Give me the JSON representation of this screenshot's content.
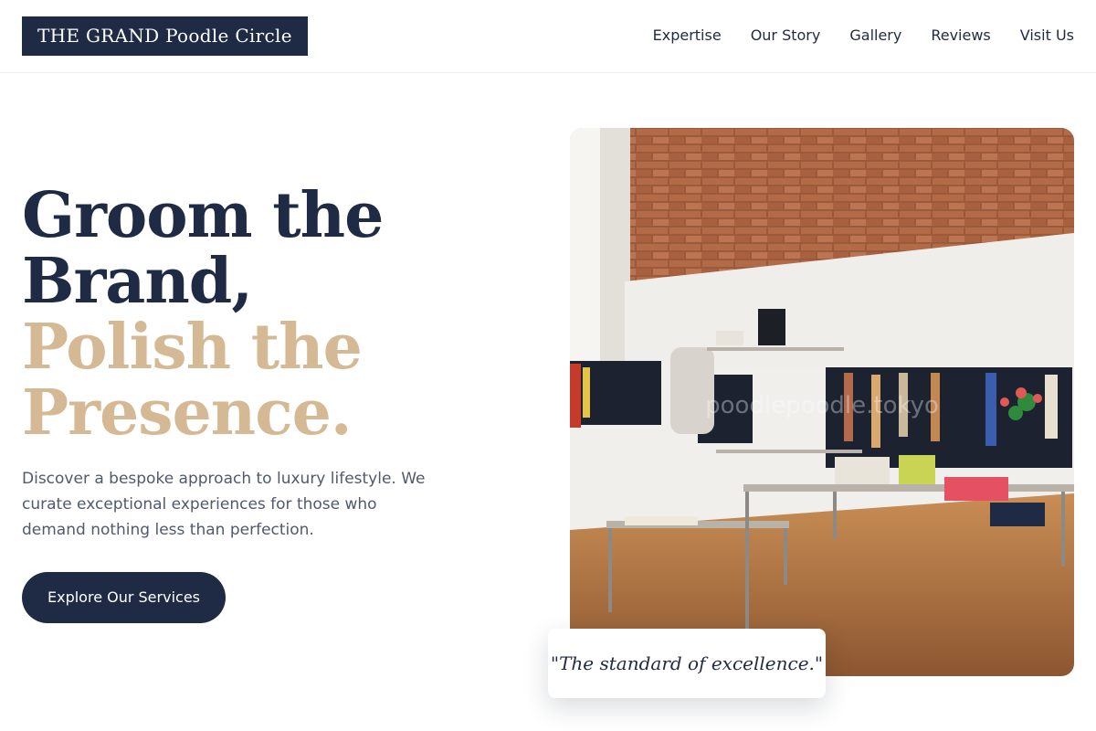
{
  "brand": {
    "name": "THE GRAND Poodle Circle"
  },
  "nav": {
    "items": [
      "Expertise",
      "Our Story",
      "Gallery",
      "Reviews",
      "Visit Us"
    ]
  },
  "hero": {
    "headline_line1": "Groom the",
    "headline_line2": "Brand,",
    "headline_accent_line1": "Polish the",
    "headline_accent_line2": "Presence.",
    "description": "Discover a bespoke approach to luxury lifestyle. We curate exceptional experiences for those who demand nothing less than perfection.",
    "cta_label": "Explore Our Services"
  },
  "image": {
    "watermark": "poodlepoodle.tokyo"
  },
  "quote": {
    "text": "\"The standard of excellence.\""
  },
  "colors": {
    "navy": "#1f2a44",
    "gold": "#d4b994",
    "text_muted": "#4f5a6f"
  }
}
